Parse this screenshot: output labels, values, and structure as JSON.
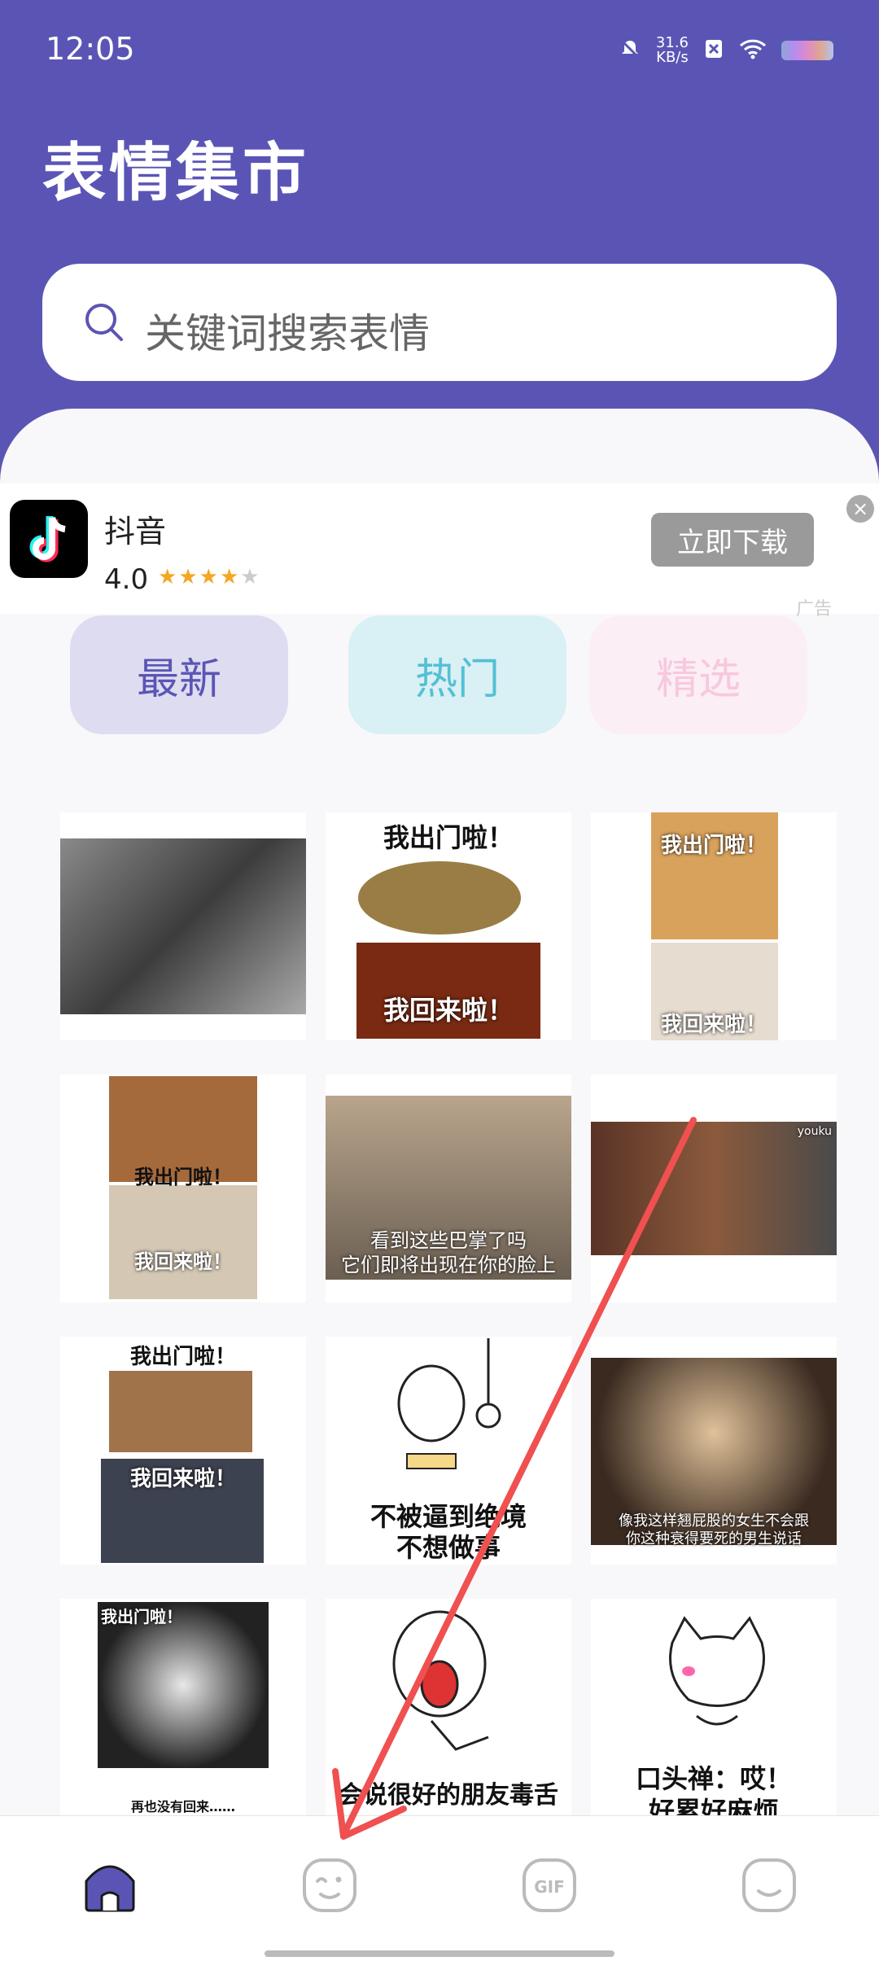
{
  "status_bar": {
    "time": "12:05",
    "net_speed": "31.6",
    "net_unit": "KB/s"
  },
  "header": {
    "title": "表情集市"
  },
  "search": {
    "placeholder": "关键词搜索表情"
  },
  "ad": {
    "app_name": "抖音",
    "rating": "4.0",
    "stars_filled": 4,
    "download_label": "立即下载",
    "ad_label": "广告"
  },
  "tabs": [
    {
      "label": "最新"
    },
    {
      "label": "热门"
    },
    {
      "label": "精选"
    }
  ],
  "grid": [
    {
      "caption": ""
    },
    {
      "caption": "我出门啦！",
      "caption2": "我回来啦！"
    },
    {
      "caption": "我出门啦！",
      "caption2": "我回来啦！"
    },
    {
      "caption": "我出门啦！",
      "caption2": "我回来啦！"
    },
    {
      "caption": "看到这些巴掌了吗",
      "caption2": "它们即将出现在你的脸上"
    },
    {
      "caption": "youku"
    },
    {
      "caption": "我出门啦！",
      "caption2": "我回来啦！"
    },
    {
      "caption": "不被逼到绝境",
      "caption2": "不想做事"
    },
    {
      "caption": "像我这样翘屁股的女生不会跟",
      "caption2": "你这种衰得要死的男生说话"
    },
    {
      "caption": "我出门啦！",
      "caption2": "再也没有回来……"
    },
    {
      "caption": "会说很好的朋友毒舌"
    },
    {
      "caption": "口头禅：哎！",
      "caption2": "好累好麻烦"
    }
  ],
  "bottom_nav": [
    {
      "icon": "home-icon"
    },
    {
      "icon": "emoji-wink-icon"
    },
    {
      "icon": "gif-icon",
      "label": "GIF"
    },
    {
      "icon": "smile-icon"
    }
  ],
  "colors": {
    "brand": "#5a55b5",
    "arrow": "#f05050"
  }
}
